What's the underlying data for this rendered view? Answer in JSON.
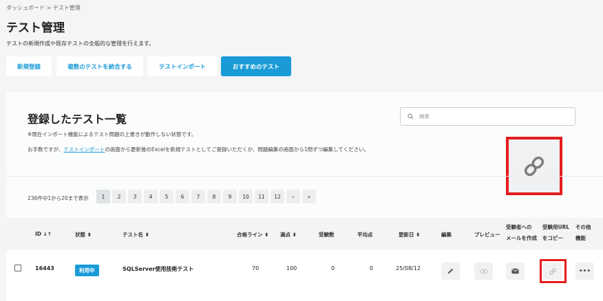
{
  "breadcrumb": "ダッシュボード > テスト管理",
  "page_title": "テスト管理",
  "page_desc": "テストの新規作成や既存テストの全般的な管理を行えます。",
  "top_buttons": {
    "new": "新規登録",
    "merge": "複数のテストを統合する",
    "import": "テストインポート",
    "recommend": "おすすめのテスト"
  },
  "list": {
    "title": "登録したテスト一覧",
    "note1": "※現在インポート機能によるテスト問題の上書きが動作しない状態です。",
    "note2_pre": "お手数ですが、",
    "note2_link": "テストインポート",
    "note2_post": "の画面から更新後のExcelを新規テストとしてご登録いただくか、問題編集の画面から1問ずつ編集してください。",
    "search_placeholder": "検索"
  },
  "pagination": {
    "info": "236件中1から20まで表示",
    "pages": [
      "1",
      "2",
      "3",
      "4",
      "5",
      "6",
      "7",
      "8",
      "9",
      "10",
      "11",
      "12"
    ],
    "next": "›",
    "last": "»"
  },
  "table": {
    "headers": {
      "id": "ID ↓↑",
      "status": "状態 ⬍",
      "name": "テスト名 ⬍",
      "pass": "合格ライン ⬍",
      "full": "満点 ⬍",
      "examinees": "受験数",
      "average": "平均点",
      "updated": "更新日 ⬍",
      "edit": "編集",
      "preview": "プレビュー",
      "mail_line1": "受験者への",
      "mail_line2": "メールを作成",
      "url_line1": "受験用URL",
      "url_line2": "をコピー",
      "other_line1": "その他",
      "other_line2": "機能"
    },
    "rows": [
      {
        "id": "16443",
        "status": "利用中",
        "name": "SQLServer使用技術テスト",
        "pass": "70",
        "full": "100",
        "examinees": "0",
        "average": "0",
        "updated": "25/08/12",
        "more": "•••"
      }
    ]
  },
  "colors": {
    "accent": "#1a9bd7",
    "highlight": "#e41c1c"
  }
}
